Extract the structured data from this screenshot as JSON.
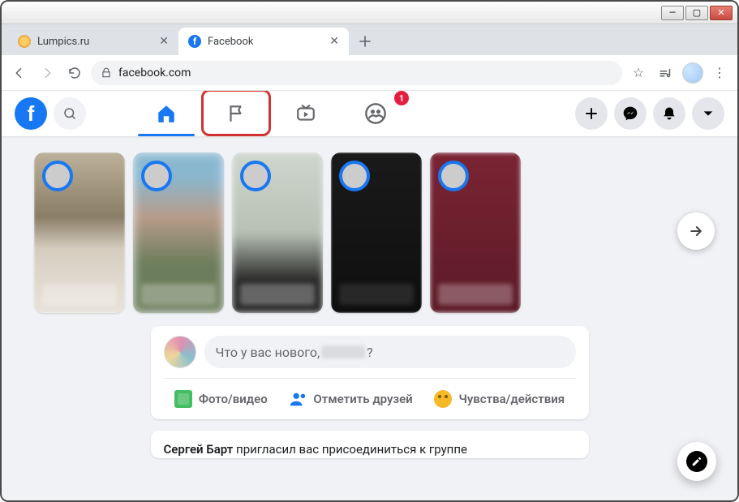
{
  "browser": {
    "tabs": [
      {
        "title": "Lumpics.ru",
        "active": false
      },
      {
        "title": "Facebook",
        "active": true
      }
    ],
    "url_domain": "facebook.com",
    "icons": {
      "star": "☆",
      "menu": "⋮"
    }
  },
  "fb": {
    "badge_groups": "1",
    "composer_prompt_prefix": "Что у вас нового, ",
    "composer_prompt_suffix": "?",
    "actions": {
      "photo": "Фото/видео",
      "tag": "Отметить друзей",
      "feel": "Чувства/действия"
    },
    "invite_name": "Сергей Барт",
    "invite_rest": " пригласил вас присоединиться к группе"
  }
}
